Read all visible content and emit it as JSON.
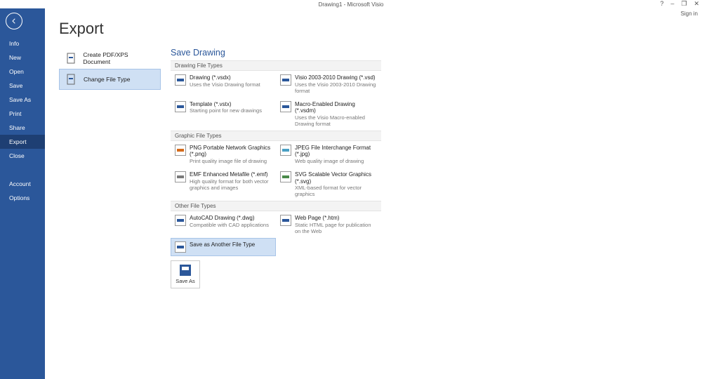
{
  "window": {
    "title": "Drawing1 - Microsoft Visio",
    "signin": "Sign in",
    "help": "?",
    "minimize": "–",
    "restore": "❐",
    "close": "✕"
  },
  "sidebar": {
    "items": [
      "Info",
      "New",
      "Open",
      "Save",
      "Save As",
      "Print",
      "Share",
      "Export",
      "Close"
    ],
    "selected": 7,
    "lower": [
      "Account",
      "Options"
    ]
  },
  "page": {
    "title": "Export"
  },
  "exportList": {
    "items": [
      {
        "label": "Create PDF/XPS Document",
        "icon": "pdf"
      },
      {
        "label": "Change File Type",
        "icon": "change"
      }
    ],
    "selected": 1
  },
  "savePanel": {
    "title": "Save Drawing",
    "sections": [
      {
        "header": "Drawing File Types",
        "items": [
          {
            "name": "Drawing (*.vsdx)",
            "desc": "Uses the Visio Drawing format",
            "icon": "v"
          },
          {
            "name": "Visio 2003-2010 Drawing (*.vsd)",
            "desc": "Uses the Visio 2003-2010 Drawing format",
            "icon": "v"
          },
          {
            "name": "Template (*.vstx)",
            "desc": "Starting point for new drawings",
            "icon": "v"
          },
          {
            "name": "Macro-Enabled Drawing (*.vsdm)",
            "desc": "Uses the Visio Macro-enabled Drawing format",
            "icon": "v"
          }
        ]
      },
      {
        "header": "Graphic File Types",
        "items": [
          {
            "name": "PNG Portable Network Graphics (*.png)",
            "desc": "Print quality image file of drawing",
            "icon": "png"
          },
          {
            "name": "JPEG File Interchange Format (*.jpg)",
            "desc": "Web quality image of drawing",
            "icon": "jpg"
          },
          {
            "name": "EMF Enhanced Metafile (*.emf)",
            "desc": "High quality format for both vector graphics and images",
            "icon": "emf"
          },
          {
            "name": "SVG Scalable Vector Graphics (*.svg)",
            "desc": "XML-based format for vector graphics",
            "icon": "svg"
          }
        ]
      },
      {
        "header": "Other File Types",
        "items": [
          {
            "name": "AutoCAD Drawing (*.dwg)",
            "desc": "Compatible with CAD applications",
            "icon": "v"
          },
          {
            "name": "Web Page (*.htm)",
            "desc": "Static HTML page for publication on the Web",
            "icon": "v"
          },
          {
            "name": "Save as Another File Type",
            "desc": "",
            "icon": "v",
            "selected": true
          }
        ]
      }
    ],
    "button": "Save As"
  }
}
